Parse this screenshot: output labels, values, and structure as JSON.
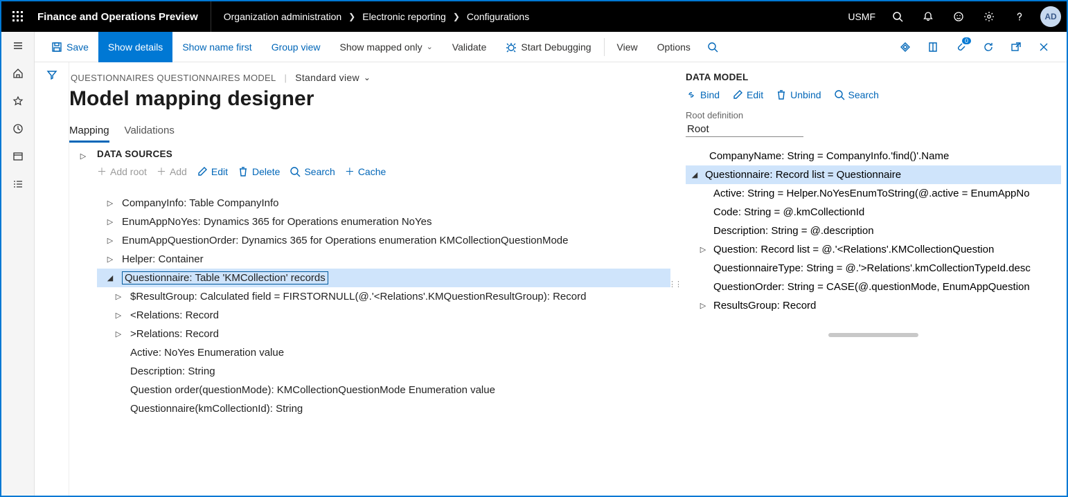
{
  "topbar": {
    "app_title": "Finance and Operations Preview",
    "breadcrumb": [
      "Organization administration",
      "Electronic reporting",
      "Configurations"
    ],
    "company": "USMF",
    "avatar": "AD"
  },
  "cmdbar": {
    "save": "Save",
    "show_details": "Show details",
    "show_name_first": "Show name first",
    "group_view": "Group view",
    "show_mapped_only": "Show mapped only",
    "validate": "Validate",
    "start_debugging": "Start Debugging",
    "view": "View",
    "options": "Options",
    "badge": "0"
  },
  "page": {
    "subtitle": "QUESTIONNAIRES QUESTIONNAIRES MODEL",
    "view_mode": "Standard view",
    "title": "Model mapping designer",
    "tabs": {
      "mapping": "Mapping",
      "validations": "Validations"
    }
  },
  "data_sources": {
    "heading": "DATA SOURCES",
    "toolbar": {
      "add_root": "Add root",
      "add": "Add",
      "edit": "Edit",
      "delete": "Delete",
      "search": "Search",
      "cache": "Cache"
    },
    "tree": [
      {
        "lvl": 0,
        "expand": "▷",
        "label": "CompanyInfo: Table CompanyInfo"
      },
      {
        "lvl": 0,
        "expand": "▷",
        "label": "EnumAppNoYes: Dynamics 365 for Operations enumeration NoYes"
      },
      {
        "lvl": 0,
        "expand": "▷",
        "label": "EnumAppQuestionOrder: Dynamics 365 for Operations enumeration KMCollectionQuestionMode"
      },
      {
        "lvl": 0,
        "expand": "▷",
        "label": "Helper: Container"
      },
      {
        "lvl": 0,
        "expand": "◢",
        "label": "Questionnaire: Table 'KMCollection' records",
        "selected": true
      },
      {
        "lvl": 1,
        "expand": "▷",
        "label": "$ResultGroup: Calculated field = FIRSTORNULL(@.'<Relations'.KMQuestionResultGroup): Record"
      },
      {
        "lvl": 1,
        "expand": "▷",
        "label": "<Relations: Record"
      },
      {
        "lvl": 1,
        "expand": "▷",
        "label": ">Relations: Record"
      },
      {
        "lvl": 1,
        "expand": "",
        "label": "Active: NoYes Enumeration value"
      },
      {
        "lvl": 1,
        "expand": "",
        "label": "Description: String"
      },
      {
        "lvl": 1,
        "expand": "",
        "label": "Question order(questionMode): KMCollectionQuestionMode Enumeration value"
      },
      {
        "lvl": 1,
        "expand": "",
        "label": "Questionnaire(kmCollectionId): String"
      }
    ]
  },
  "data_model": {
    "heading": "DATA MODEL",
    "toolbar": {
      "bind": "Bind",
      "edit": "Edit",
      "unbind": "Unbind",
      "search": "Search"
    },
    "root_label": "Root definition",
    "root_value": "Root",
    "tree": [
      {
        "lvl": 0,
        "expand": "",
        "label": "CompanyName: String = CompanyInfo.'find()'.Name"
      },
      {
        "lvl": 0,
        "expand": "◢",
        "label": "Questionnaire: Record list = Questionnaire",
        "selected": true,
        "hasToggle": true
      },
      {
        "lvl": 1,
        "expand": "",
        "label": "Active: String = Helper.NoYesEnumToString(@.active = EnumAppNo"
      },
      {
        "lvl": 1,
        "expand": "",
        "label": "Code: String = @.kmCollectionId"
      },
      {
        "lvl": 1,
        "expand": "",
        "label": "Description: String = @.description"
      },
      {
        "lvl": 1,
        "expand": "▷",
        "label": "Question: Record list = @.'<Relations'.KMCollectionQuestion",
        "hasToggle": true
      },
      {
        "lvl": 1,
        "expand": "",
        "label": "QuestionnaireType: String = @.'>Relations'.kmCollectionTypeId.desc"
      },
      {
        "lvl": 1,
        "expand": "",
        "label": "QuestionOrder: String = CASE(@.questionMode, EnumAppQuestion"
      },
      {
        "lvl": 1,
        "expand": "▷",
        "label": "ResultsGroup: Record",
        "hasToggle": true
      }
    ]
  }
}
